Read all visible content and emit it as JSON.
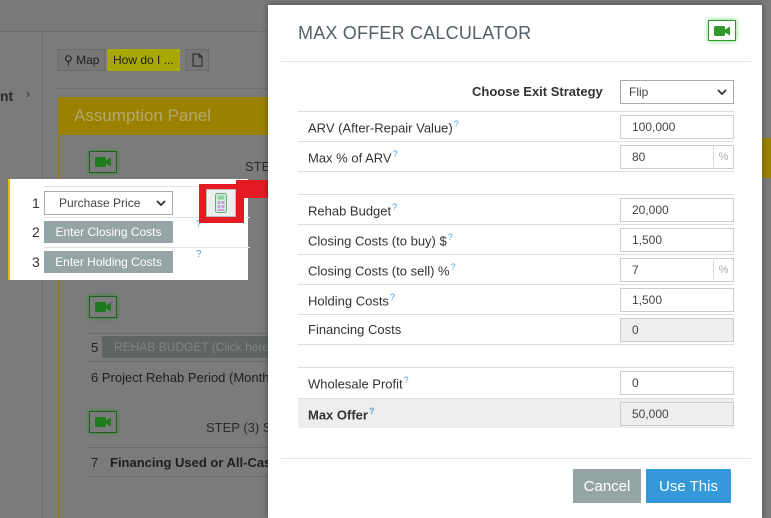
{
  "background": {
    "sidebar_item_partial": "nt",
    "toolbar": {
      "map_label": "Map",
      "how_label": "How do I ...",
      "doc_icon": "document-icon"
    },
    "panel_title": "Assumption Panel",
    "step1_partial": "STE",
    "callout": {
      "rows": [
        {
          "num": "1",
          "select_value": "Purchase Price",
          "help": "?"
        },
        {
          "num": "2",
          "button_label": "Enter Closing Costs",
          "help": "?"
        },
        {
          "num": "3",
          "button_label": "Enter Holding Costs",
          "help": "?"
        }
      ],
      "calculator_icon": "calculator-icon"
    },
    "row5_num": "5",
    "row5_label": "REHAB BUDGET (Click here",
    "row6_label": "6 Project Rehab Period (Month",
    "step3_partial": "STEP (3) S",
    "row7_num": "7",
    "row7_label": "Financing Used or All-Cas"
  },
  "modal": {
    "title": "MAX OFFER CALCULATOR",
    "video_icon": "video-camera-icon",
    "exit_strategy": {
      "label": "Choose Exit Strategy",
      "selected": "Flip"
    },
    "fields": [
      {
        "label": "ARV (After-Repair Value)",
        "help": "?",
        "value": "100,000"
      },
      {
        "label": "Max % of ARV",
        "help": "?",
        "value": "80",
        "addon": "%"
      },
      {
        "label": "Rehab Budget",
        "help": "?",
        "value": "20,000"
      },
      {
        "label": "Closing Costs (to buy) $",
        "help": "?",
        "value": "1,500"
      },
      {
        "label": "Closing Costs (to sell) %",
        "help": "?",
        "value": "7",
        "addon": "%"
      },
      {
        "label": "Holding Costs",
        "help": "?",
        "value": "1,500"
      },
      {
        "label": "Financing Costs",
        "value": "0"
      },
      {
        "label": "Wholesale Profit",
        "help": "?",
        "value": "0"
      },
      {
        "label": "Max Offer",
        "help": "?",
        "value": "50,000"
      }
    ],
    "buttons": {
      "cancel": "Cancel",
      "use_this": "Use This"
    }
  },
  "colors": {
    "primary": "#3498db",
    "secondary": "#95a5a6",
    "highlight_red": "#e51b24",
    "video_green": "#2e9a2e",
    "panel_gold": "#c9a800"
  }
}
